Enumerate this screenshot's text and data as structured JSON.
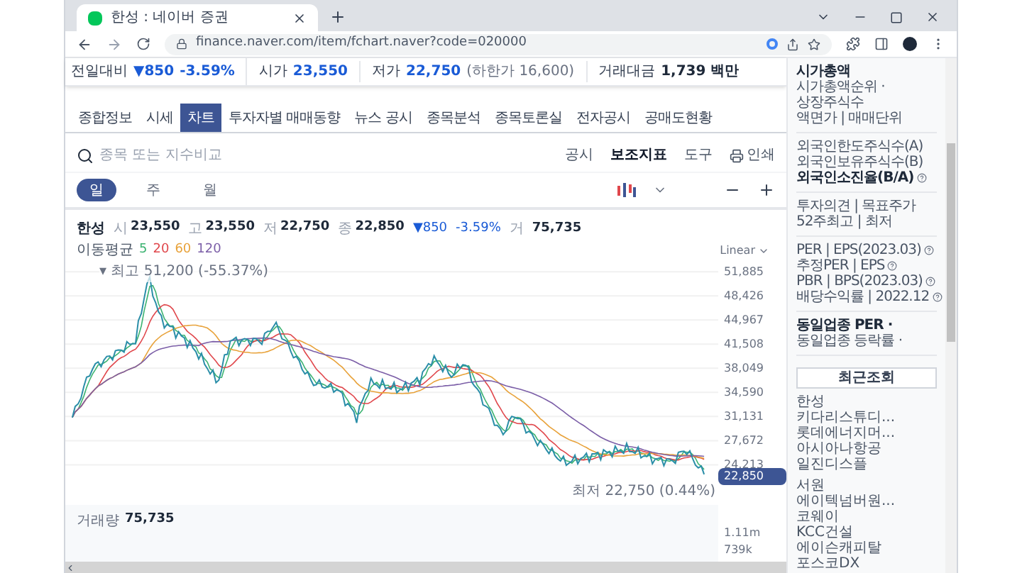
{
  "browser": {
    "tab_title": "한성 : 네이버 증권",
    "url": "finance.naver.com/item/fchart.naver?code=020000"
  },
  "quote_bar": {
    "change_label": "전일대비",
    "change": "▼850",
    "change_rate": "-3.59%",
    "items": [
      {
        "label": "시가",
        "value": "23,550"
      },
      {
        "label": "저가",
        "value": "22,750",
        "note": "(하한가 16,600)"
      },
      {
        "label": "거래대금",
        "value": "1,739 백만"
      }
    ]
  },
  "tabs": [
    {
      "label": "종합정보",
      "selected": false
    },
    {
      "label": "시세",
      "selected": false
    },
    {
      "label": "차트",
      "selected": true
    },
    {
      "label": "투자자별 매매동향",
      "selected": false
    },
    {
      "label": "뉴스 공시",
      "selected": false
    },
    {
      "label": "종목분석",
      "selected": false
    },
    {
      "label": "종목토론실",
      "selected": false
    },
    {
      "label": "전자공시",
      "selected": false
    },
    {
      "label": "공매도현황",
      "selected": false
    }
  ],
  "search": {
    "placeholder": "종목 또는 지수비교"
  },
  "toolbar": [
    {
      "label": "공시",
      "kind": "text",
      "bold": false
    },
    {
      "label": "보조지표",
      "kind": "text",
      "bold": true
    },
    {
      "label": "도구",
      "kind": "text",
      "bold": false
    },
    {
      "label": "인쇄",
      "kind": "print",
      "bold": false
    }
  ],
  "periods": [
    {
      "label": "일",
      "selected": true
    },
    {
      "label": "주",
      "selected": false
    },
    {
      "label": "월",
      "selected": false
    }
  ],
  "summary": {
    "name": "한성",
    "items": [
      {
        "label": "시",
        "value": "23,550"
      },
      {
        "label": "고",
        "value": "23,550"
      },
      {
        "label": "저",
        "value": "22,750"
      },
      {
        "label": "종",
        "value": "22,850"
      }
    ],
    "change": "▼850",
    "change_rate": "-3.59%",
    "volume_label": "거",
    "volume": "75,735"
  },
  "moving_average": {
    "label": "이동평균",
    "periods": [
      {
        "label": "5",
        "color": "#3cb371"
      },
      {
        "label": "20",
        "color": "#e0474c"
      },
      {
        "label": "60",
        "color": "#e8a23a"
      },
      {
        "label": "120",
        "color": "#7b5ea7"
      }
    ]
  },
  "chart": {
    "scale": "Linear",
    "y_labels": [
      "51,885",
      "48,426",
      "44,967",
      "41,508",
      "38,049",
      "34,590",
      "31,131",
      "27,672",
      "24,213"
    ],
    "high_marker": "▾ 최고 51,200 (-55.37%)",
    "low_marker": "최저 22,750 (0.44%)",
    "current_price": "22,850",
    "volume_label": "거래량",
    "volume": "75,735",
    "volume_labels": [
      "1.11m",
      "739k"
    ]
  },
  "sidebar": {
    "groups": [
      [
        {
          "text": "시가총액",
          "bold": true,
          "help": false
        },
        {
          "text": "시가총액순위 ·",
          "bold": false,
          "help": false
        },
        {
          "text": "상장주식수",
          "bold": false,
          "help": false
        },
        {
          "text": "액면가 | 매매단위",
          "bold": false,
          "help": false
        }
      ],
      [
        {
          "text": "외국인한도주식수(A)",
          "bold": false,
          "help": false
        },
        {
          "text": "외국인보유주식수(B)",
          "bold": false,
          "help": false
        },
        {
          "text": "외국인소진율(B/A)",
          "bold": true,
          "help": true
        }
      ],
      [
        {
          "text": "투자의견 | 목표주가",
          "bold": false,
          "help": false
        },
        {
          "text": "52주최고 | 최저",
          "bold": false,
          "help": false
        }
      ],
      [
        {
          "text": "PER | EPS(2023.03)",
          "bold": false,
          "help": true
        },
        {
          "text": "추정PER | EPS",
          "bold": false,
          "help": true
        },
        {
          "text": "PBR | BPS(2023.03)",
          "bold": false,
          "help": true
        },
        {
          "text": "배당수익률 | 2022.12",
          "bold": false,
          "help": true
        }
      ],
      [
        {
          "text": "동일업종 PER ·",
          "bold": true,
          "help": false
        },
        {
          "text": "동일업종 등락률 ·",
          "bold": false,
          "help": false
        }
      ]
    ],
    "recent": {
      "title": "최근조회",
      "groups": [
        [
          "한성",
          "키다리스튜디...",
          "롯데에너지머...",
          "아시아나항공",
          "일진디스플"
        ],
        [
          "서원",
          "에이텍넘버원...",
          "코웨이",
          "KCC건설",
          "에이슨캐피탈",
          "포스코DX"
        ]
      ]
    }
  }
}
